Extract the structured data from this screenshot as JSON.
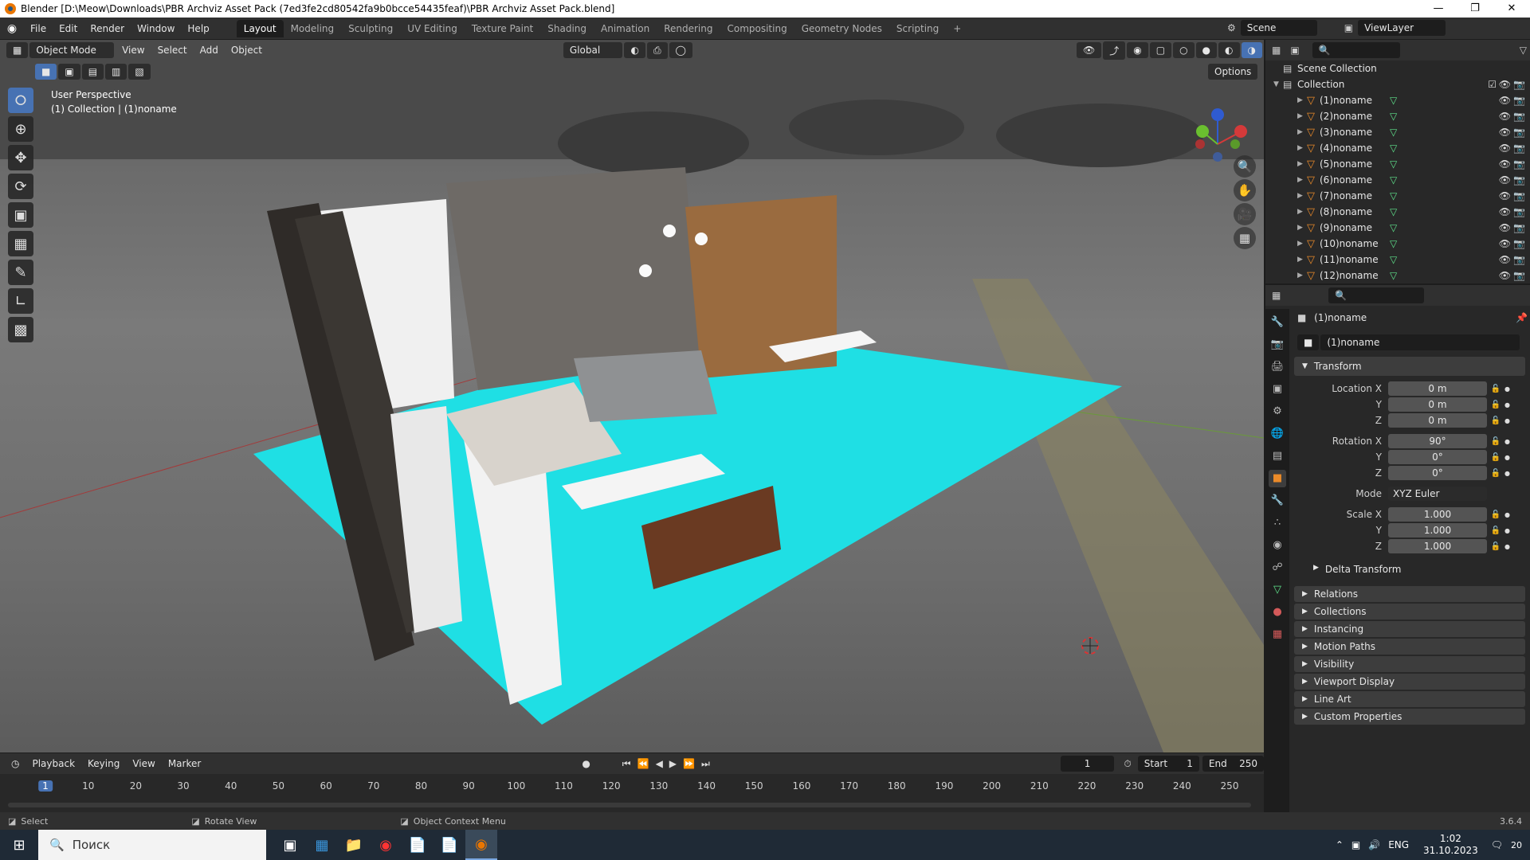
{
  "window": {
    "title": "Blender [D:\\Meow\\Downloads\\PBR Archviz Asset Pack (7ed3fe2cd80542fa9b0bcce54435feaf)\\PBR Archviz Asset Pack.blend]",
    "minimize": "—",
    "maximize": "❐",
    "close": "✕"
  },
  "menu": [
    "File",
    "Edit",
    "Render",
    "Window",
    "Help"
  ],
  "workspaces": [
    "Layout",
    "Modeling",
    "Sculpting",
    "UV Editing",
    "Texture Paint",
    "Shading",
    "Animation",
    "Rendering",
    "Compositing",
    "Geometry Nodes",
    "Scripting"
  ],
  "workspace_add": "+",
  "scene": {
    "label": "Scene",
    "view_layer": "ViewLayer"
  },
  "viewport": {
    "mode": "Object Mode",
    "menus": [
      "View",
      "Select",
      "Add",
      "Object"
    ],
    "orientation": "Global",
    "options": "Options",
    "perspective": "User Perspective",
    "collection_info": "(1) Collection | (1)noname"
  },
  "outliner": {
    "scene_collection": "Scene Collection",
    "collection": "Collection",
    "objects": [
      "(1)noname",
      "(2)noname",
      "(3)noname",
      "(4)noname",
      "(5)noname",
      "(6)noname",
      "(7)noname",
      "(8)noname",
      "(9)noname",
      "(10)noname",
      "(11)noname",
      "(12)noname"
    ]
  },
  "properties": {
    "object_name": "(1)noname",
    "object_field": "(1)noname",
    "transform_label": "Transform",
    "location": {
      "label": "Location X",
      "x": "0 m",
      "y": "0 m",
      "z": "0 m"
    },
    "rotation": {
      "label": "Rotation X",
      "x": "90°",
      "y": "0°",
      "z": "0°"
    },
    "axis_y": "Y",
    "axis_z": "Z",
    "mode": {
      "label": "Mode",
      "value": "XYZ Euler"
    },
    "scale": {
      "label": "Scale X",
      "x": "1.000",
      "y": "1.000",
      "z": "1.000"
    },
    "delta_transform": "Delta Transform",
    "panels": [
      "Relations",
      "Collections",
      "Instancing",
      "Motion Paths",
      "Visibility",
      "Viewport Display",
      "Line Art",
      "Custom Properties"
    ]
  },
  "timeline": {
    "menus": [
      "Playback",
      "Keying",
      "View",
      "Marker"
    ],
    "current_frame": "1",
    "start_label": "Start",
    "start": "1",
    "end_label": "End",
    "end": "250",
    "ticks": [
      "1",
      "10",
      "20",
      "30",
      "40",
      "50",
      "60",
      "70",
      "80",
      "90",
      "100",
      "110",
      "120",
      "130",
      "140",
      "150",
      "160",
      "170",
      "180",
      "190",
      "200",
      "210",
      "220",
      "230",
      "240",
      "250"
    ]
  },
  "status": {
    "select": "Select",
    "rotate": "Rotate View",
    "context": "Object Context Menu",
    "version": "3.6.4"
  },
  "taskbar": {
    "search_placeholder": "Поиск",
    "lang": "ENG",
    "time": "1:02",
    "date": "31.10.2023",
    "notifications": "20"
  },
  "colors": {
    "accent": "#4772b3",
    "object_orange": "#ea8a29",
    "mesh_green": "#5fe28b",
    "floor_cyan": "#1fdfe4",
    "frame_blue": "#4772b3"
  }
}
